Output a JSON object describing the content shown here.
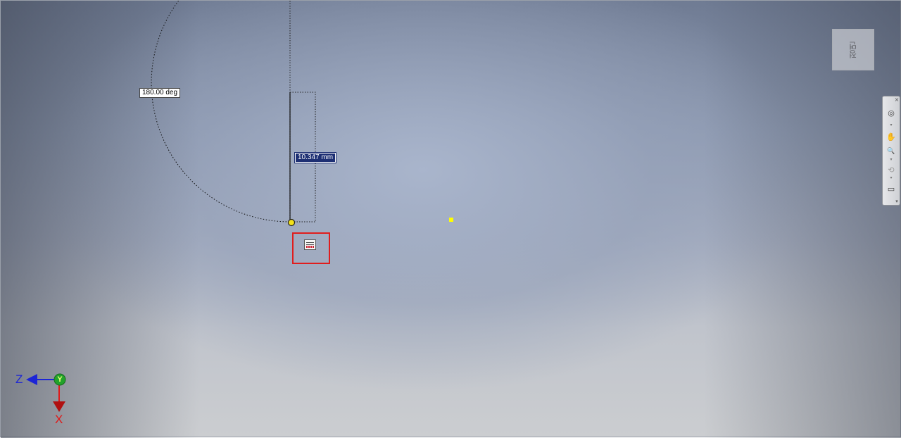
{
  "sketch": {
    "angle_dimension": "180.00 deg",
    "length_dimension": "10.347 mm"
  },
  "viewcube": {
    "face_label": "정면"
  },
  "navigation_bar": {
    "close_glyph": "×",
    "full_navigation_wheel": "◎",
    "pan": "✋",
    "zoom": "🔍",
    "orbit": "⟲",
    "look_at": "▭",
    "drop_arrow": "▾",
    "customize": "▾"
  },
  "triad": {
    "z_label": "Z",
    "y_label": "Y",
    "x_label": "X"
  },
  "colors": {
    "dimension_active_bg": "#1d2f73",
    "glyph_highlight": "#e01d1d",
    "selection_point": "#ffff00",
    "axis_x": "#e01818",
    "axis_y": "#22a32a",
    "axis_z": "#1c25d6"
  }
}
